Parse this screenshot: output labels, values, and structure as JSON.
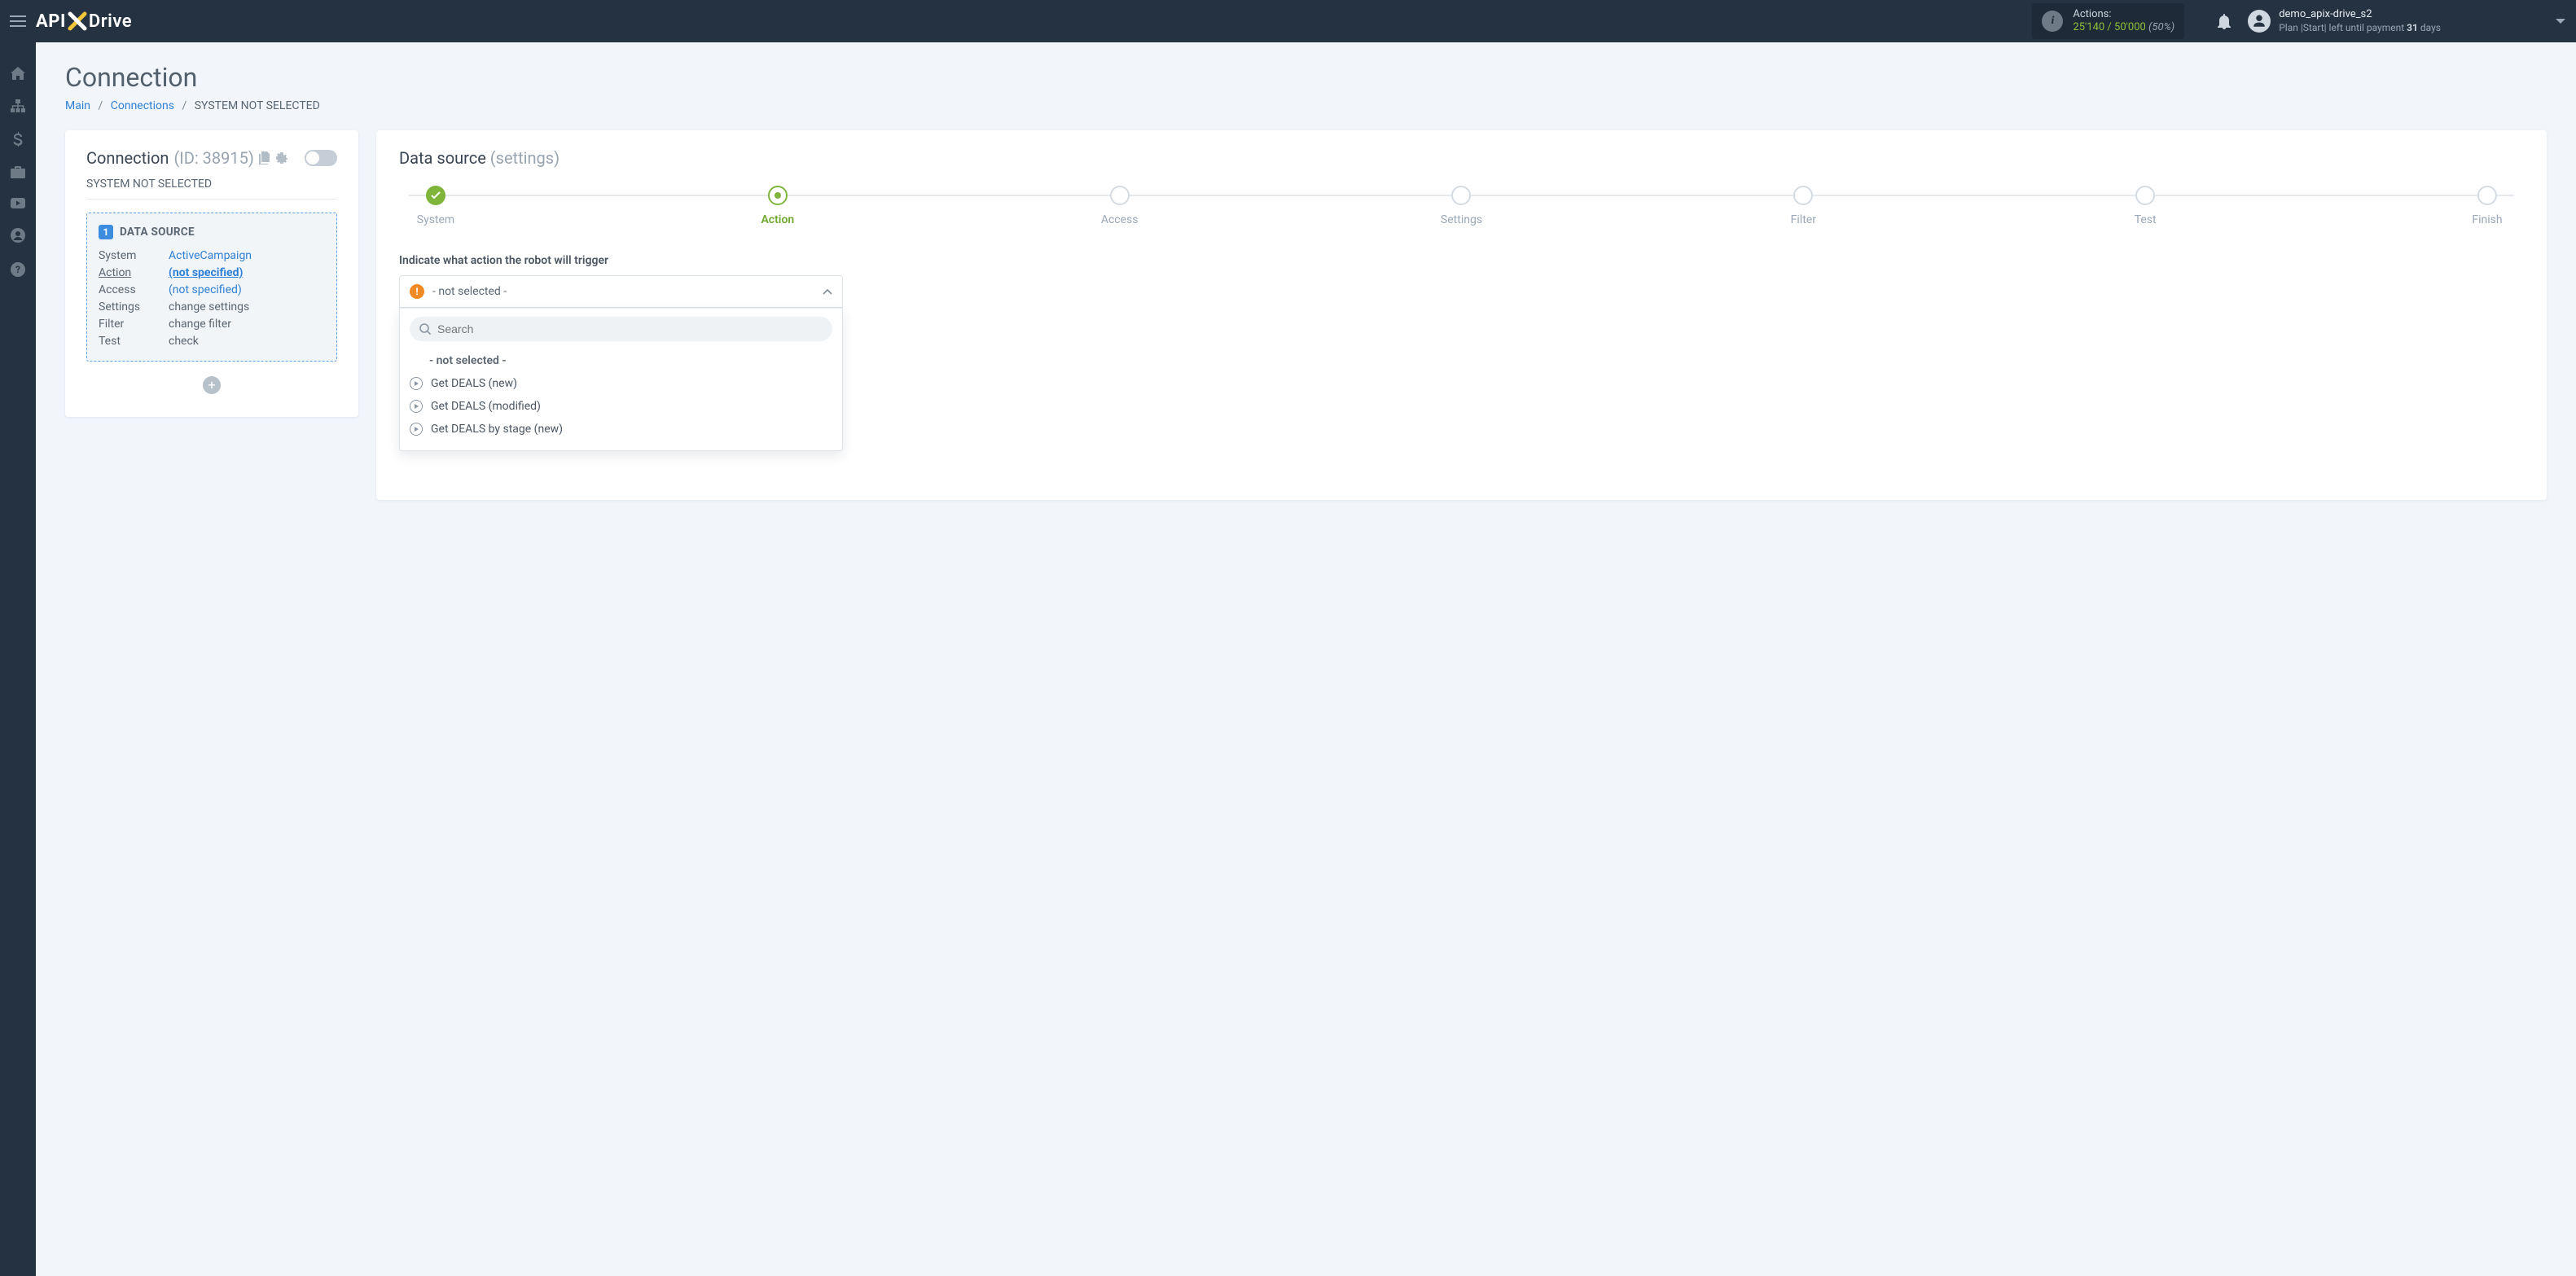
{
  "header": {
    "logo": {
      "api": "API",
      "x": "X",
      "drive": "Drive"
    },
    "actions": {
      "label": "Actions:",
      "used": "25'140",
      "sep": " / ",
      "total": "50'000",
      "pct": "(50%)"
    },
    "user": {
      "name": "demo_apix-drive_s2",
      "plan_prefix": "Plan |",
      "plan_name": "Start",
      "plan_mid": "| left until payment ",
      "days": "31",
      "plan_suffix": " days"
    }
  },
  "page": {
    "title": "Connection",
    "breadcrumb": {
      "main": "Main",
      "connections": "Connections",
      "current": "SYSTEM NOT SELECTED"
    }
  },
  "connection_card": {
    "title": "Connection",
    "id_label": "(ID: 38915)",
    "subheader": "SYSTEM NOT SELECTED",
    "box_title": "DATA SOURCE",
    "rows": {
      "system": {
        "k": "System",
        "v": "ActiveCampaign"
      },
      "action": {
        "k": "Action",
        "v": "(not specified)"
      },
      "access": {
        "k": "Access",
        "v": "(not specified)"
      },
      "settings": {
        "k": "Settings",
        "v": "change settings"
      },
      "filter": {
        "k": "Filter",
        "v": "change filter"
      },
      "test": {
        "k": "Test",
        "v": "check"
      }
    }
  },
  "data_source": {
    "title": "Data source",
    "subtitle": "(settings)",
    "steps": [
      "System",
      "Action",
      "Access",
      "Settings",
      "Filter",
      "Test",
      "Finish"
    ],
    "prompt": "Indicate what action the robot will trigger",
    "selected": "- not selected -",
    "search_placeholder": "Search",
    "options": [
      "- not selected -",
      "Get DEALS (new)",
      "Get DEALS (modified)",
      "Get DEALS by stage (new)"
    ]
  }
}
